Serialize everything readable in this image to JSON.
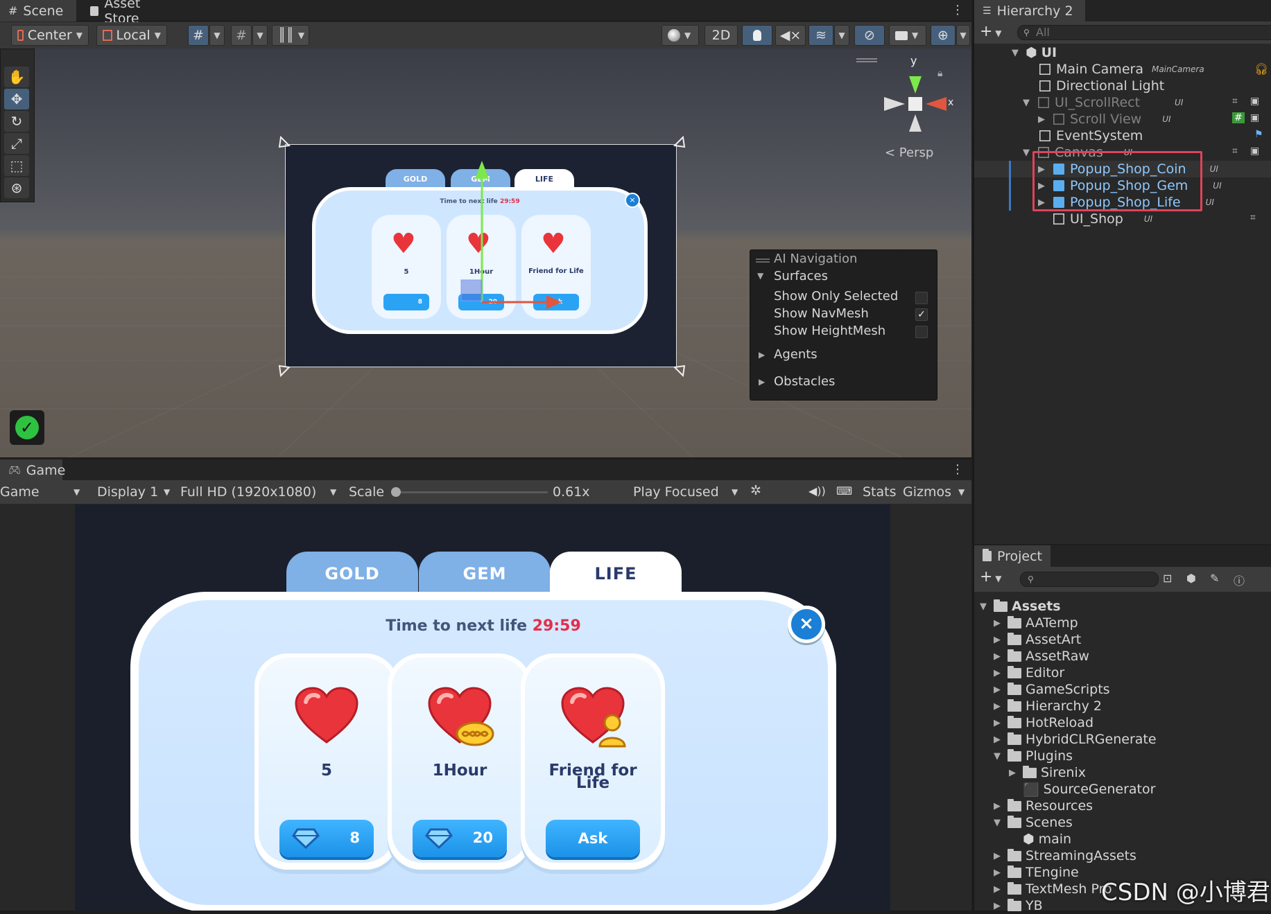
{
  "scene_tabs": {
    "scene": "Scene",
    "asset_store": "Asset Store"
  },
  "scene_toolbar": {
    "pivot": "Center",
    "space": "Local",
    "mode_2d": "2D"
  },
  "scene_gizmo": {
    "y": "y",
    "x": "x",
    "persp": "< Persp"
  },
  "ai_navigation": {
    "title": "AI Navigation",
    "surfaces": "Surfaces",
    "show_only_selected": "Show Only Selected",
    "show_navmesh": "Show NavMesh",
    "show_heightmesh": "Show HeightMesh",
    "agents": "Agents",
    "obstacles": "Obstacles",
    "show_only_selected_checked": false,
    "show_navmesh_checked": true,
    "show_heightmesh_checked": false
  },
  "hierarchy": {
    "title": "Hierarchy 2",
    "search_placeholder": "All",
    "root": "UI",
    "items": [
      {
        "label": "Main Camera",
        "tag": "MainCamera"
      },
      {
        "label": "Directional Light",
        "tag": ""
      },
      {
        "label": "UI_ScrollRect",
        "tag": "UI"
      },
      {
        "label": "Scroll View",
        "tag": "UI"
      },
      {
        "label": "EventSystem",
        "tag": ""
      },
      {
        "label": "Canvas",
        "tag": "UI"
      },
      {
        "label": "Popup_Shop_Coin",
        "tag": "UI"
      },
      {
        "label": "Popup_Shop_Gem",
        "tag": "UI"
      },
      {
        "label": "Popup_Shop_Life",
        "tag": "UI"
      },
      {
        "label": "UI_Shop",
        "tag": "UI"
      }
    ]
  },
  "project": {
    "title": "Project",
    "root": "Assets",
    "items": [
      "AATemp",
      "AssetArt",
      "AssetRaw",
      "Editor",
      "GameScripts",
      "Hierarchy 2",
      "HotReload",
      "HybridCLRGenerate",
      "Plugins",
      "Sirenix",
      "SourceGenerator",
      "Resources",
      "Scenes",
      "main",
      "StreamingAssets",
      "TEngine",
      "TextMesh Pro",
      "YB"
    ]
  },
  "game_tab": "Game",
  "game_toolbar": {
    "mode": "Game",
    "display": "Display 1",
    "resolution": "Full HD (1920x1080)",
    "scale_label": "Scale",
    "scale_value": "0.61x",
    "play_mode": "Play Focused",
    "stats": "Stats",
    "gizmos": "Gizmos"
  },
  "popup": {
    "tabs": [
      "GOLD",
      "GEM",
      "LIFE"
    ],
    "timer_label": "Time to next life",
    "timer_value": "29:59",
    "cards": [
      {
        "label": "5",
        "button": "8"
      },
      {
        "label": "1Hour",
        "button": "20"
      },
      {
        "label": "Friend for Life",
        "button": "Ask"
      }
    ]
  },
  "watermark": "CSDN @小博君",
  "colors": {
    "accent_selection": "#46607c",
    "highlight_box": "#e0435a",
    "tab_blue": "#7fb0e6",
    "popup_bg": "#cfe6ff",
    "timer_red": "#e0304a",
    "button_blue": "#2aa3f5"
  }
}
